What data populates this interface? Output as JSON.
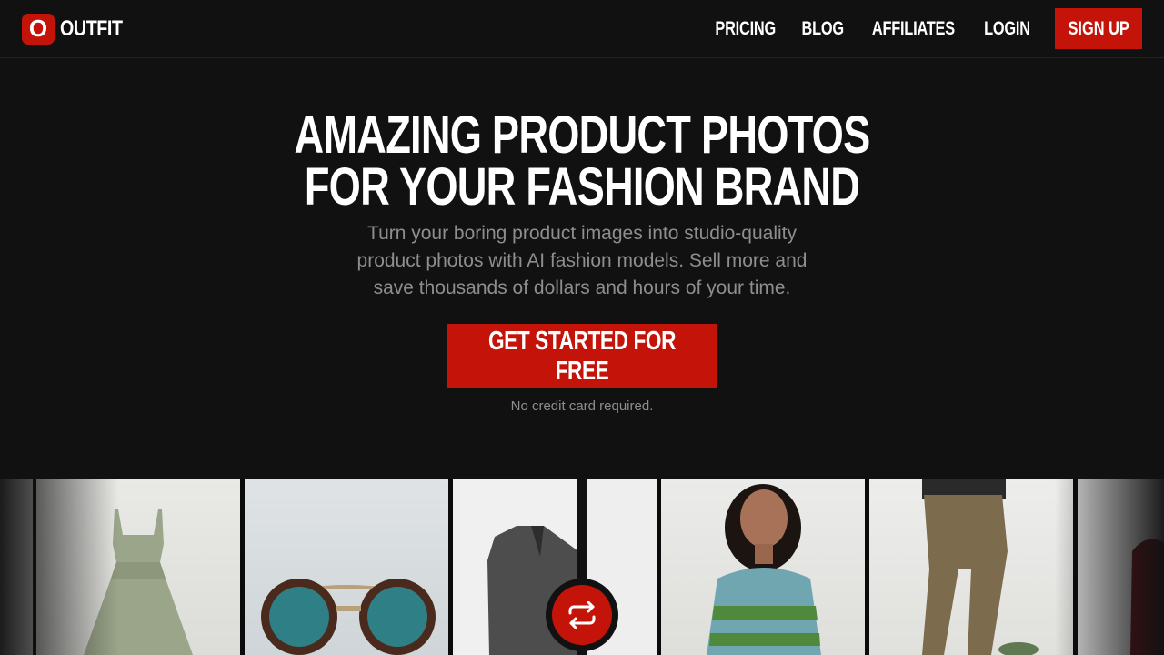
{
  "brand": {
    "mark": "O",
    "name": "OUTFIT",
    "accent": "#c4140a"
  },
  "nav": {
    "links": [
      "PRICING",
      "BLOG",
      "AFFILIATES",
      "LOGIN"
    ],
    "signup_label": "SIGN UP"
  },
  "hero": {
    "title_line1": "AMAZING PRODUCT PHOTOS",
    "title_line2": "FOR YOUR FASHION BRAND",
    "subtitle": "Turn your boring product images into studio-quality product photos with AI fashion models. Sell more and save thousands of dollars and hours of your time.",
    "cta_label": "GET STARTED FOR FREE",
    "note": "No credit card required."
  },
  "gallery": {
    "items": [
      "dress-photo",
      "sunglasses-photo",
      "coat-photo",
      "sweater-model-photo",
      "trousers-model-photo"
    ],
    "swap_icon": "swap-arrows-icon"
  }
}
